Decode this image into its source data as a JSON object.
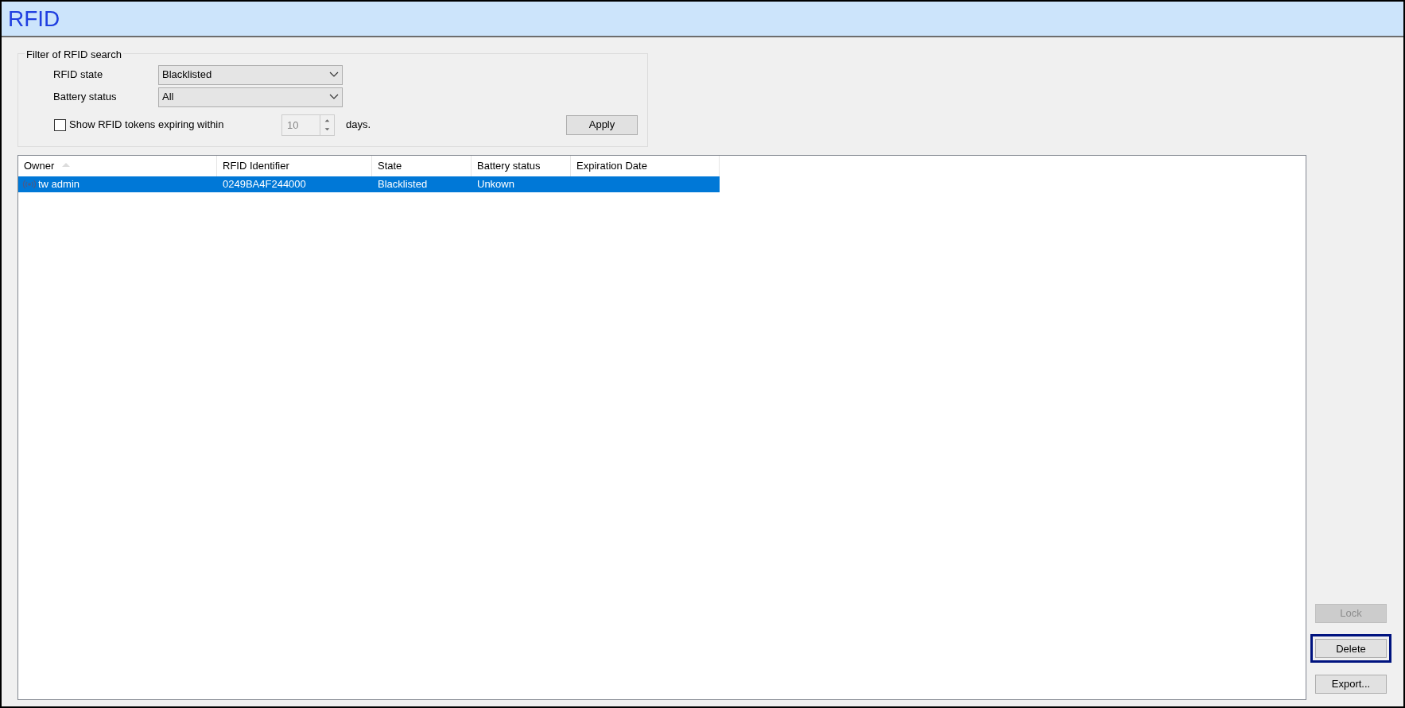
{
  "window": {
    "title": "RFID"
  },
  "filter": {
    "legend": "Filter of RFID search",
    "rfid_state": {
      "label": "RFID state",
      "value": "Blacklisted"
    },
    "battery_status": {
      "label": "Battery status",
      "value": "All"
    },
    "expiring": {
      "label": "Show RFID tokens expiring within",
      "checked": false,
      "value": "10",
      "disabled": true,
      "suffix": "days."
    },
    "apply_button": "Apply"
  },
  "table": {
    "columns": [
      {
        "label": "Owner",
        "sorted": true
      },
      {
        "label": "RFID Identifier",
        "sorted": false
      },
      {
        "label": "State",
        "sorted": false
      },
      {
        "label": "Battery status",
        "sorted": false
      },
      {
        "label": "Expiration Date",
        "sorted": false
      }
    ],
    "rows": [
      {
        "selected": true,
        "cells": [
          "tw admin",
          "0249BA4F244000",
          "Blacklisted",
          "Unkown",
          ""
        ]
      }
    ]
  },
  "buttons": [
    {
      "label": "Lock",
      "disabled": true,
      "highlighted": false
    },
    {
      "label": "Delete",
      "disabled": false,
      "highlighted": true
    },
    {
      "label": "Export...",
      "disabled": false,
      "highlighted": false
    }
  ]
}
